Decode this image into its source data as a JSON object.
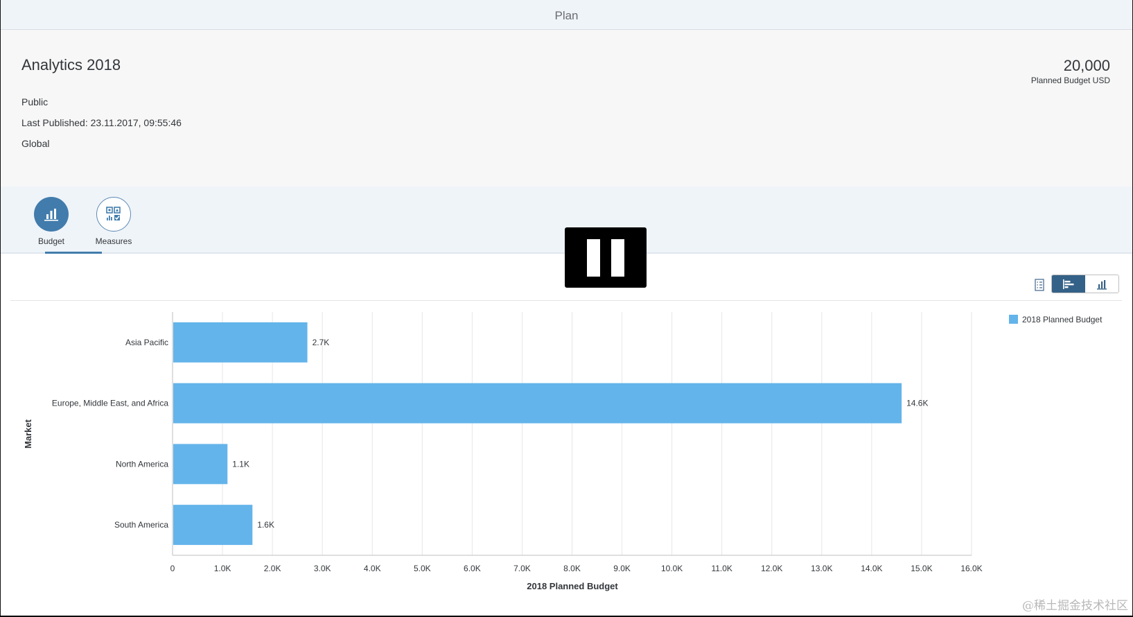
{
  "shell": {
    "title": "Plan"
  },
  "header": {
    "title": "Analytics 2018",
    "attributes": {
      "visibility": "Public",
      "last_published": "Last Published: 23.11.2017, 09:55:46",
      "scope": "Global"
    },
    "kpi": {
      "value": "20,000",
      "label": "Planned Budget USD"
    }
  },
  "tabs": [
    {
      "label": "Budget",
      "icon": "bar-chart-icon",
      "selected": true
    },
    {
      "label": "Measures",
      "icon": "measures-icon",
      "selected": false
    }
  ],
  "toolbar": {
    "table_view_icon": "table-view-icon",
    "bar_view_icon": "horizontal-bar-chart-icon",
    "column_view_icon": "column-chart-icon",
    "selected_view": "bar"
  },
  "watermark": "@稀土掘金技术社区",
  "colors": {
    "bar": "#63b4ea",
    "accent": "#427cac",
    "toolbar_selected": "#346187"
  },
  "chart_data": {
    "type": "bar",
    "orientation": "horizontal",
    "categories": [
      "Asia Pacific",
      "Europe, Middle East, and Africa",
      "North America",
      "South America"
    ],
    "series": [
      {
        "name": "2018 Planned Budget",
        "values": [
          2700,
          14600,
          1100,
          1600
        ]
      }
    ],
    "data_labels": [
      "2.7K",
      "14.6K",
      "1.1K",
      "1.6K"
    ],
    "xlabel": "2018 Planned Budget",
    "ylabel": "Market",
    "xlim": [
      0,
      16000
    ],
    "x_ticks": [
      0,
      1000,
      2000,
      3000,
      4000,
      5000,
      6000,
      7000,
      8000,
      9000,
      10000,
      11000,
      12000,
      13000,
      14000,
      15000,
      16000
    ],
    "x_tick_labels": [
      "0",
      "1.0K",
      "2.0K",
      "3.0K",
      "4.0K",
      "5.0K",
      "6.0K",
      "7.0K",
      "8.0K",
      "9.0K",
      "10.0K",
      "11.0K",
      "12.0K",
      "13.0K",
      "14.0K",
      "15.0K",
      "16.0K"
    ],
    "grid": true,
    "legend": "top-right"
  }
}
